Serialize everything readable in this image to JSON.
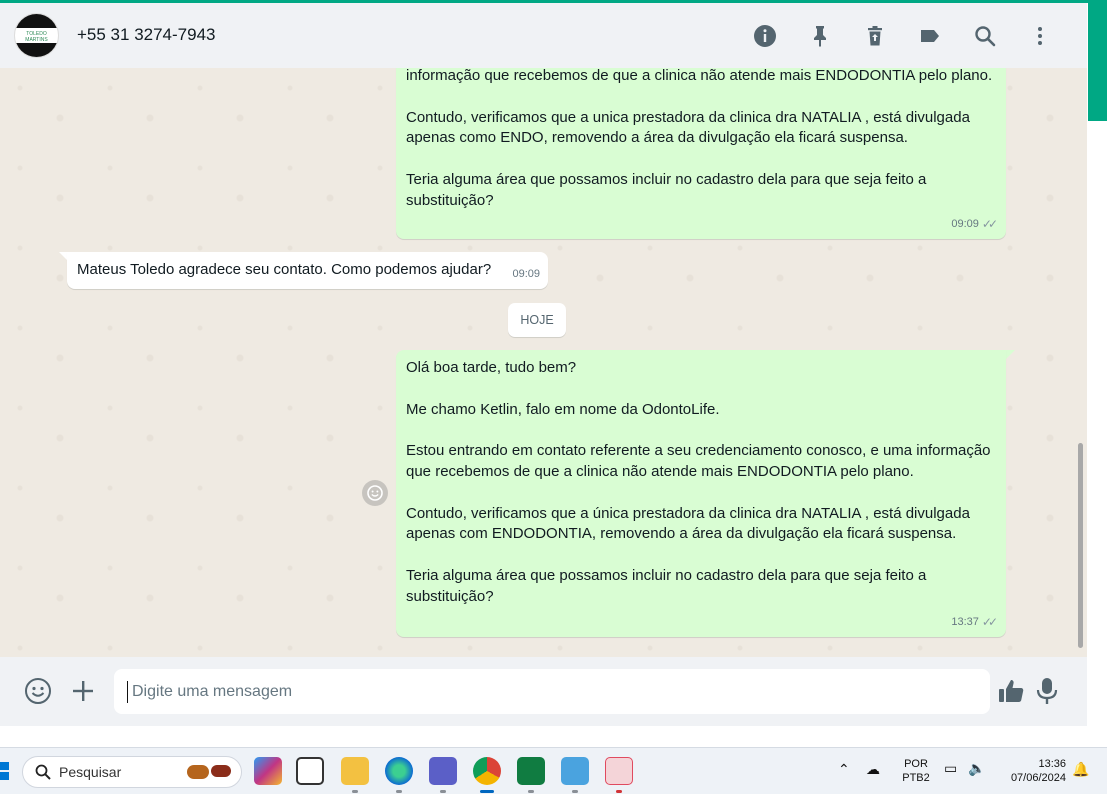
{
  "header": {
    "contact_name": "+55 31 3274-7943",
    "avatar_text": "TOLEDO MARTINS",
    "icons": [
      "info-icon",
      "pin-icon",
      "delete-icon",
      "label-icon",
      "search-icon",
      "more-icon"
    ]
  },
  "messages": [
    {
      "direction": "out",
      "paragraphs": [
        "informação que recebemos de que a clinica não atende mais ENDODONTIA pelo plano.",
        "Contudo, verificamos que a unica prestadora da clinica dra NATALIA , está divulgada apenas como ENDO, removendo a área da divulgação ela ficará suspensa.",
        "Teria alguma área que possamos incluir no cadastro dela para que seja feito a substituição?"
      ],
      "time": "09:09",
      "status": "read"
    },
    {
      "direction": "in",
      "text": "Mateus Toledo agradece seu contato. Como podemos ajudar?",
      "time": "09:09"
    },
    {
      "direction": "out",
      "paragraphs": [
        "Olá boa tarde, tudo bem?",
        "Me chamo Ketlin, falo em nome da OdontoLife.",
        "Estou entrando em contato referente a seu credenciamento conosco, e uma informação que recebemos de que a clinica não atende mais ENDODONTIA pelo plano.",
        "Contudo, verificamos que a única prestadora da clinica dra NATALIA , está divulgada apenas com ENDODONTIA, removendo a área da divulgação ela ficará suspensa.",
        "Teria alguma área que possamos incluir no cadastro dela para que seja feito a substituição?"
      ],
      "time": "13:37",
      "status": "read"
    }
  ],
  "date_divider": "HOJE",
  "composer": {
    "placeholder": "Digite uma mensagem",
    "value": ""
  },
  "taskbar": {
    "search_placeholder": "Pesquisar",
    "apps": [
      "copilot-icon",
      "task-view-icon",
      "file-explorer-icon",
      "edge-icon",
      "teams-icon",
      "chrome-icon",
      "excel-icon",
      "notepad-icon",
      "snipping-tool-icon"
    ],
    "language_line1": "POR",
    "language_line2": "PTB2",
    "time": "13:36",
    "date": "07/06/2024"
  },
  "colors": {
    "accent": "#00a884",
    "outgoing_bubble": "#d9fdd3",
    "chat_background": "#efeae2"
  }
}
